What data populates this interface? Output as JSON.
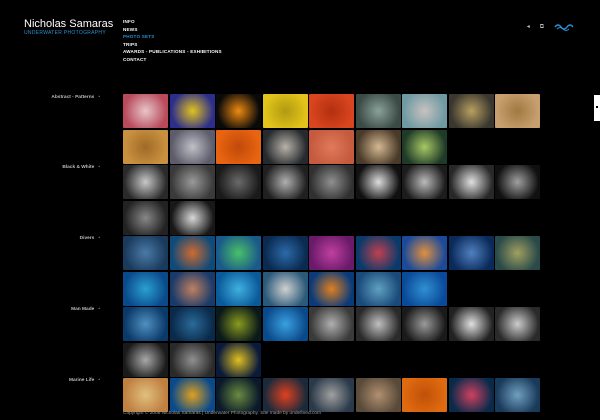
{
  "header": {
    "title": "Nicholas Samaras",
    "subtitle": "UNDERWATER PHOTOGRAPHY"
  },
  "nav": {
    "items": [
      {
        "label": "INFO",
        "active": false
      },
      {
        "label": "NEWS",
        "active": false
      },
      {
        "label": "PHOTO SETS",
        "active": true
      },
      {
        "label": "TRIPS",
        "active": false
      },
      {
        "label": "AWARDS - PUBLICATIONS - EXHIBITIONS",
        "active": false
      },
      {
        "label": "CONTACT",
        "active": false
      }
    ]
  },
  "icons": {
    "back": "◂",
    "window": "⧉",
    "brand": "wave-logo-icon"
  },
  "colors": {
    "accent": "#2a8fd0",
    "background": "#000000"
  },
  "categories": [
    {
      "label": "Abstract - Patterns",
      "thumbs": [
        [
          "#b84a5c",
          "#e8c6c9"
        ],
        [
          "#2c2e8a",
          "#e3c21e"
        ],
        [
          "#0a0a0a",
          "#f08a10"
        ],
        [
          "#e3c41b",
          "#b09a10"
        ],
        [
          "#d9451f",
          "#b23010"
        ],
        [
          "#3a4a44",
          "#8aa19a"
        ],
        [
          "#6f9aa3",
          "#c8c2c0"
        ],
        [
          "#3a3630",
          "#b8a060"
        ],
        [
          "#c8a070",
          "#a07840"
        ],
        [
          "#c9913f",
          "#a06a28"
        ],
        [
          "#5c5c6a",
          "#c0c0c8"
        ],
        [
          "#e86410",
          "#c04a0a"
        ],
        [
          "#262a2e",
          "#b8b2a8"
        ],
        [
          "#c55a3e",
          "#e07a5a"
        ],
        [
          "#4a3a2a",
          "#d4b890"
        ],
        [
          "#1e3a28",
          "#a8c864"
        ]
      ]
    },
    {
      "label": "Black & White",
      "thumbs": [
        [
          "#2a2a2a",
          "#c8c8c8"
        ],
        [
          "#3a3a3a",
          "#9a9a9a"
        ],
        [
          "#1a1a1a",
          "#6a6a6a"
        ],
        [
          "#202020",
          "#b0b0b0"
        ],
        [
          "#303030",
          "#909090"
        ],
        [
          "#111111",
          "#dddddd"
        ],
        [
          "#1c1c1c",
          "#bbbbbb"
        ],
        [
          "#282828",
          "#e0e0e0"
        ],
        [
          "#101010",
          "#a0a0a0"
        ],
        [
          "#222222",
          "#888888"
        ],
        [
          "#181818",
          "#d8d8d8"
        ]
      ]
    },
    {
      "label": "Divers",
      "thumbs": [
        [
          "#1a3a5c",
          "#4a7aa8"
        ],
        [
          "#0e4a7a",
          "#d06a30"
        ],
        [
          "#1a5a8a",
          "#4ac068"
        ],
        [
          "#0a2a50",
          "#2c6aa8"
        ],
        [
          "#6a1a6a",
          "#c040a0"
        ],
        [
          "#0a3a6a",
          "#c04050"
        ],
        [
          "#1a4a9a",
          "#e09040"
        ],
        [
          "#0a2a5a",
          "#5080c0"
        ],
        [
          "#2a4a4a",
          "#a0a060"
        ],
        [
          "#0a4a8a",
          "#2aa0d0"
        ],
        [
          "#1a3a6a",
          "#c08060"
        ],
        [
          "#0a5a9a",
          "#40b0e0"
        ],
        [
          "#2a5a7a",
          "#d0d0d0"
        ],
        [
          "#0a3a7a",
          "#e08020"
        ],
        [
          "#1a4a7a",
          "#60a0c0"
        ],
        [
          "#0a4a9a",
          "#3090d0"
        ]
      ]
    },
    {
      "label": "Man Made",
      "thumbs": [
        [
          "#0a3a6a",
          "#5090c0"
        ],
        [
          "#0a2a4a",
          "#2a6a9a"
        ],
        [
          "#0a1a1a",
          "#8a9a20"
        ],
        [
          "#0a4a8a",
          "#3aa0e0"
        ],
        [
          "#3a3a3a",
          "#b0b0b0"
        ],
        [
          "#2a2a2a",
          "#c0c0c0"
        ],
        [
          "#1a1a1a",
          "#9a9a9a"
        ],
        [
          "#222222",
          "#e0e0e0"
        ],
        [
          "#2a2a2a",
          "#cccccc"
        ],
        [
          "#1a1a1a",
          "#a8a8a8"
        ],
        [
          "#2a2a2a",
          "#909090"
        ],
        [
          "#0a1a3a",
          "#e0c020"
        ]
      ]
    },
    {
      "label": "Marine Life",
      "thumbs": [
        [
          "#c08040",
          "#e0c080"
        ],
        [
          "#0a4a8a",
          "#e0a020"
        ],
        [
          "#0a1a2a",
          "#6a8a40"
        ],
        [
          "#1a2a3a",
          "#e04020"
        ],
        [
          "#2a3a4a",
          "#a0a0a0"
        ],
        [
          "#5a4a3a",
          "#b09070"
        ],
        [
          "#e06a10",
          "#c05008"
        ],
        [
          "#0a2a4a",
          "#d04060"
        ],
        [
          "#1a3a5a",
          "#70a0c0"
        ]
      ]
    }
  ],
  "footer": {
    "text": "Copyright © 2008 Nicholas Samaras | Underwater Photography. Site made by undefined.com"
  }
}
